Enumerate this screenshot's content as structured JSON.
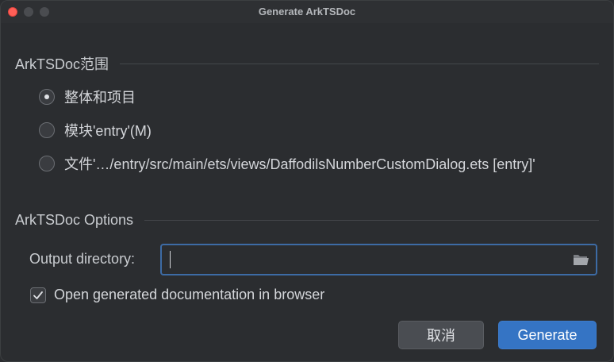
{
  "window": {
    "title": "Generate ArkTSDoc"
  },
  "scope_section": {
    "label": "ArkTSDoc范围",
    "options": [
      {
        "label": "整体和项目",
        "selected": true
      },
      {
        "label": "模块'entry'(M)",
        "selected": false
      },
      {
        "label": "文件'…/entry/src/main/ets/views/DaffodilsNumberCustomDialog.ets [entry]'",
        "selected": false
      }
    ]
  },
  "options_section": {
    "label": "ArkTSDoc Options",
    "output_directory": {
      "label": "Output directory:",
      "value": "",
      "placeholder": ""
    },
    "open_in_browser": {
      "label": "Open generated documentation in browser",
      "checked": true
    }
  },
  "buttons": {
    "cancel_label": "取消",
    "generate_label": "Generate"
  },
  "icons": {
    "browse": "folder-icon",
    "checkmark": "checkmark-icon"
  },
  "colors": {
    "accent": "#3574c4",
    "focus_border": "#3d6ba5",
    "close_button": "#ff5f57"
  }
}
